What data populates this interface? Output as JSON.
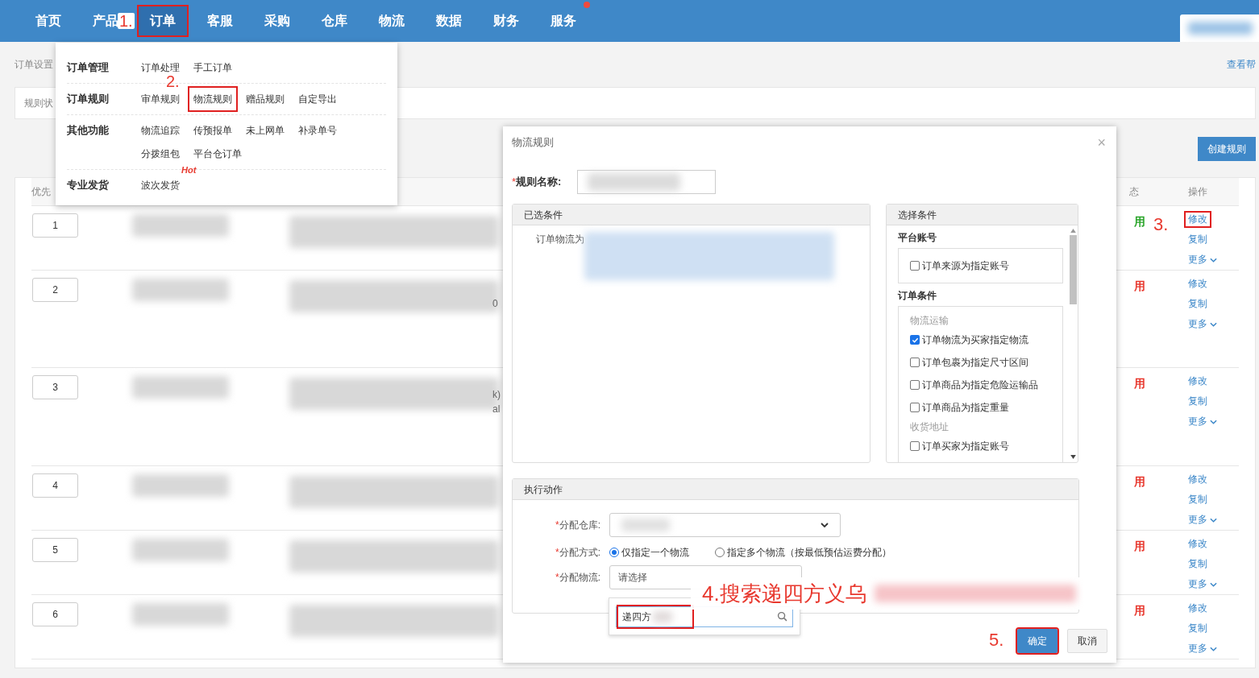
{
  "nav": {
    "items": [
      {
        "label": "首页",
        "highlighted": false,
        "dot": false
      },
      {
        "label": "产品",
        "highlighted": false,
        "dot": false
      },
      {
        "label": "订单",
        "highlighted": true,
        "dot": false
      },
      {
        "label": "客服",
        "highlighted": false,
        "dot": false
      },
      {
        "label": "采购",
        "highlighted": false,
        "dot": false
      },
      {
        "label": "仓库",
        "highlighted": false,
        "dot": false
      },
      {
        "label": "物流",
        "highlighted": false,
        "dot": false
      },
      {
        "label": "数据",
        "highlighted": false,
        "dot": false
      },
      {
        "label": "财务",
        "highlighted": false,
        "dot": false
      },
      {
        "label": "服务",
        "highlighted": false,
        "dot": true
      }
    ]
  },
  "breadcrumb": "订单设置",
  "help_link": "查看帮",
  "filter_label": "规则状",
  "create_button": "创建规则",
  "menu": {
    "groups": [
      {
        "title": "订单管理",
        "items": [
          {
            "label": "订单处理",
            "highlighted": false
          },
          {
            "label": "手工订单",
            "highlighted": false
          }
        ]
      },
      {
        "title": "订单规则",
        "items": [
          {
            "label": "审单规则",
            "highlighted": false
          },
          {
            "label": "物流规则",
            "highlighted": true
          },
          {
            "label": "赠品规则",
            "highlighted": false
          },
          {
            "label": "自定导出",
            "highlighted": false
          }
        ]
      },
      {
        "title": "其他功能",
        "items": [
          {
            "label": "物流追踪",
            "highlighted": false
          },
          {
            "label": "传预报单",
            "highlighted": false
          },
          {
            "label": "未上网单",
            "highlighted": false
          },
          {
            "label": "补录单号",
            "highlighted": false
          },
          {
            "label": "分拨组包",
            "highlighted": false
          },
          {
            "label": "平台仓订单",
            "highlighted": false
          }
        ]
      },
      {
        "title": "专业发货",
        "items": [
          {
            "label": "波次发货",
            "highlighted": false,
            "badge": "Hot"
          }
        ]
      }
    ]
  },
  "table": {
    "columns": [
      {
        "label": "优先"
      },
      {
        "label": "态"
      },
      {
        "label": "操作"
      }
    ],
    "rows": [
      {
        "priority": "1",
        "status": "用",
        "color": "#2aa52a",
        "fragments": [],
        "actions": [
          {
            "label": "修改",
            "highlighted": true
          },
          {
            "label": "复制",
            "highlighted": false
          },
          {
            "label": "更多",
            "highlighted": false
          }
        ]
      },
      {
        "priority": "2",
        "status": "用",
        "color": "#e8392f",
        "fragments": [
          "0"
        ],
        "actions": [
          {
            "label": "修改",
            "highlighted": false
          },
          {
            "label": "复制",
            "highlighted": false
          },
          {
            "label": "更多",
            "highlighted": false
          }
        ]
      },
      {
        "priority": "3",
        "status": "用",
        "color": "#e8392f",
        "fragments": [
          "k)",
          "al"
        ],
        "actions": [
          {
            "label": "修改",
            "highlighted": false
          },
          {
            "label": "复制",
            "highlighted": false
          },
          {
            "label": "更多",
            "highlighted": false
          }
        ]
      },
      {
        "priority": "4",
        "status": "用",
        "color": "#e8392f",
        "fragments": [],
        "actions": [
          {
            "label": "修改",
            "highlighted": false
          },
          {
            "label": "复制",
            "highlighted": false
          },
          {
            "label": "更多",
            "highlighted": false
          }
        ]
      },
      {
        "priority": "5",
        "status": "用",
        "color": "#e8392f",
        "fragments": [],
        "actions": [
          {
            "label": "修改",
            "highlighted": false
          },
          {
            "label": "复制",
            "highlighted": false
          },
          {
            "label": "更多",
            "highlighted": false
          }
        ]
      },
      {
        "priority": "6",
        "status": "用",
        "color": "#e8392f",
        "fragments": [],
        "actions": [
          {
            "label": "修改",
            "highlighted": false
          },
          {
            "label": "复制",
            "highlighted": false
          },
          {
            "label": "更多",
            "highlighted": false
          }
        ]
      }
    ]
  },
  "dialog": {
    "title": "物流规则",
    "close": "×",
    "name_label": {
      "mark": "*",
      "text": "规则名称:"
    },
    "selected_panel": {
      "title": "已选条件",
      "condition": "订单物流为"
    },
    "choose_panel": {
      "title": "选择条件",
      "sections": [
        {
          "title": "平台账号",
          "groups": [
            {
              "items": [
                {
                  "label": "订单来源为指定账号",
                  "checked": false
                }
              ]
            }
          ]
        },
        {
          "title": "订单条件",
          "groups": [
            {
              "title": "物流运输",
              "items": [
                {
                  "label": "订单物流为买家指定物流",
                  "checked": true
                },
                {
                  "label": "订单包裹为指定尺寸区间",
                  "checked": false
                },
                {
                  "label": "订单商品为指定危险运输品",
                  "checked": false
                },
                {
                  "label": "订单商品为指定重量",
                  "checked": false
                }
              ]
            },
            {
              "title": "收货地址",
              "items": [
                {
                  "label": "订单买家为指定账号",
                  "checked": false
                }
              ]
            }
          ]
        }
      ]
    },
    "action_panel": {
      "title": "执行动作",
      "warehouse_label": {
        "mark": "*",
        "text": "分配仓库:"
      },
      "method_label": {
        "mark": "*",
        "text": "分配方式:"
      },
      "methods": [
        {
          "label": "仅指定一个物流",
          "selected": true
        },
        {
          "label": "指定多个物流（按最低预估运费分配）",
          "selected": false
        }
      ],
      "logistics_label": {
        "mark": "*",
        "text": "分配物流:"
      },
      "logistics_placeholder": "请选择",
      "search_value": "递四方"
    },
    "buttons": [
      {
        "label": "确定",
        "kind": "primary",
        "highlighted": true
      },
      {
        "label": "取消",
        "kind": "default",
        "highlighted": false
      }
    ]
  },
  "annotations": [
    {
      "text": "1."
    },
    {
      "text": "2."
    },
    {
      "text": "3."
    },
    {
      "text": "4.搜索递四方义乌"
    },
    {
      "text": "5."
    }
  ]
}
